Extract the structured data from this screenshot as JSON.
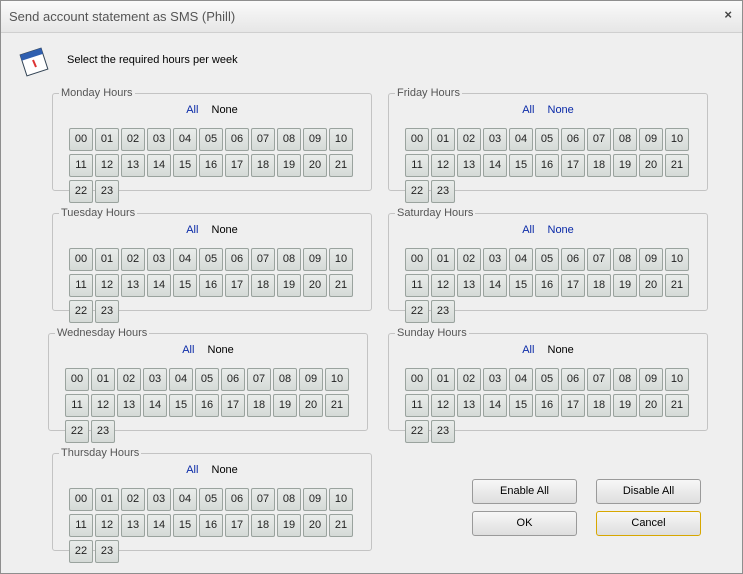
{
  "window": {
    "title": "Send account statement as SMS (Phill)",
    "close_glyph": "×"
  },
  "instruction": "Select the required hours per week",
  "links": {
    "all": "All",
    "none": "None"
  },
  "hours": [
    "00",
    "01",
    "02",
    "03",
    "04",
    "05",
    "06",
    "07",
    "08",
    "09",
    "10",
    "11",
    "12",
    "13",
    "14",
    "15",
    "16",
    "17",
    "18",
    "19",
    "20",
    "21",
    "22",
    "23"
  ],
  "days": [
    {
      "id": "monday",
      "label": "Monday Hours"
    },
    {
      "id": "tuesday",
      "label": "Tuesday Hours"
    },
    {
      "id": "wednesday",
      "label": "Wednesday Hours"
    },
    {
      "id": "thursday",
      "label": "Thursday Hours"
    },
    {
      "id": "friday",
      "label": "Friday Hours"
    },
    {
      "id": "saturday",
      "label": "Saturday Hours"
    },
    {
      "id": "sunday",
      "label": "Sunday Hours"
    }
  ],
  "buttons": {
    "enable_all": "Enable All",
    "disable_all": "Disable All",
    "ok": "OK",
    "cancel": "Cancel"
  }
}
